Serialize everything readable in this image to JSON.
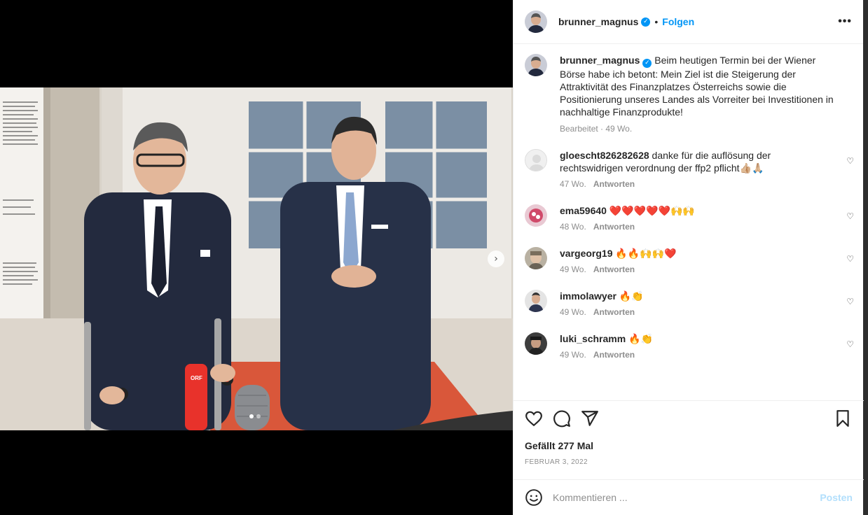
{
  "post": {
    "author": "brunner_magnus",
    "follow_label": "Folgen",
    "separator": "•",
    "more_label": "•••",
    "caption": "Beim heutigen Termin bei der Wiener Börse habe ich betont: Mein Ziel ist die Steigerung der Attraktivität des Finanzplatzes Österreichs sowie die Positionierung unseres Landes als Vorreiter bei Investitionen in nachhaltige Finanzprodukte!",
    "caption_meta": "Bearbeitet · 49 Wo.",
    "likes": "Gefällt 277 Mal",
    "date": "FEBRUAR 3, 2022"
  },
  "comments": [
    {
      "user": "gloescht826282628",
      "text": "danke für die auflösung der rechtswidrigen verordnung der ffp2 pflicht👍🏼🙏🏼",
      "age": "47 Wo.",
      "reply": "Antworten"
    },
    {
      "user": "ema59640",
      "text": "❤️❤️❤️❤️❤️🙌🙌",
      "age": "48 Wo.",
      "reply": "Antworten"
    },
    {
      "user": "vargeorg19",
      "text": "🔥🔥🙌🙌❤️",
      "age": "49 Wo.",
      "reply": "Antworten"
    },
    {
      "user": "immolawyer",
      "text": "🔥👏",
      "age": "49 Wo.",
      "reply": "Antworten"
    },
    {
      "user": "luki_schramm",
      "text": "🔥👏",
      "age": "49 Wo.",
      "reply": "Antworten"
    }
  ],
  "composer": {
    "placeholder": "Kommentieren ...",
    "post_label": "Posten"
  },
  "photo": {
    "mic_logo": "ORF"
  },
  "colors": {
    "accent": "#0095f6",
    "post_disabled": "#b2dffc",
    "muted": "#8e8e8e"
  },
  "icons": [
    "verified-badge-icon",
    "more-options-icon",
    "heart-icon",
    "comment-icon",
    "share-icon",
    "bookmark-icon",
    "emoji-icon",
    "chevron-right-icon"
  ]
}
